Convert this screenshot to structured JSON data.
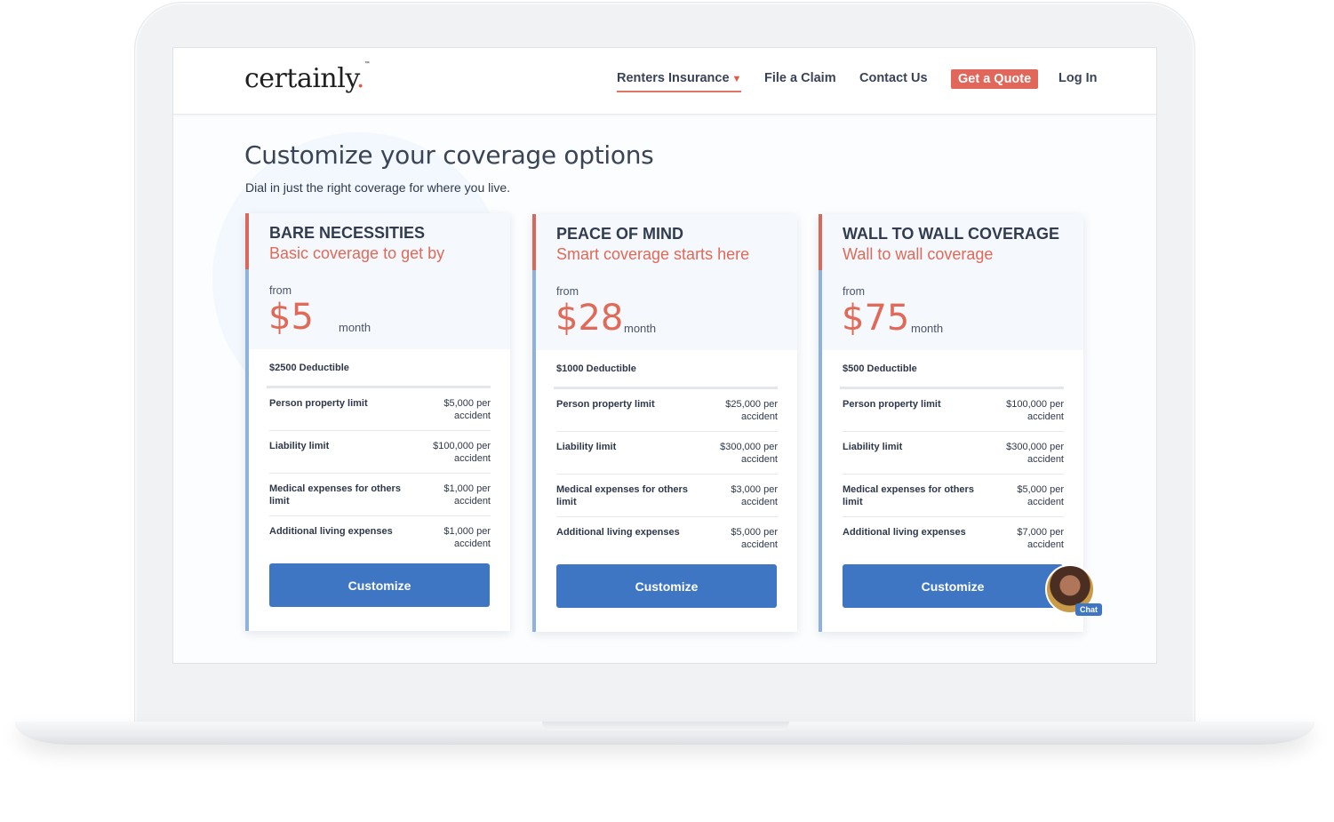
{
  "header": {
    "logo_text": "certainly",
    "logo_dot": ".",
    "logo_tm": "™",
    "nav": {
      "renters": "Renters Insurance",
      "claim": "File a Claim",
      "contact": "Contact Us",
      "quote": "Get a Quote",
      "login": "Log In"
    }
  },
  "main": {
    "title": "Customize your coverage options",
    "subtitle": "Dial in just the right coverage for where you live."
  },
  "plans": [
    {
      "name": "BARE NECESSITIES",
      "tagline": "Basic coverage to get by",
      "from": "from",
      "price": "$5",
      "per": "month",
      "deductible": "$2500 Deductible",
      "rows": [
        {
          "label": "Person property limit",
          "value": "$5,000 per accident"
        },
        {
          "label": "Liability limit",
          "value": "$100,000 per accident"
        },
        {
          "label": "Medical expenses for others limit",
          "value": "$1,000 per accident"
        },
        {
          "label": "Additional living expenses",
          "value": "$1,000 per accident"
        }
      ],
      "button": "Customize"
    },
    {
      "name": "PEACE OF MIND",
      "tagline": "Smart coverage starts here",
      "from": "from",
      "price": "$28",
      "per": "month",
      "deductible": "$1000 Deductible",
      "rows": [
        {
          "label": "Person property limit",
          "value": "$25,000 per accident"
        },
        {
          "label": "Liability limit",
          "value": "$300,000 per accident"
        },
        {
          "label": "Medical expenses for others limit",
          "value": "$3,000 per accident"
        },
        {
          "label": "Additional living expenses",
          "value": "$5,000 per accident"
        }
      ],
      "button": "Customize"
    },
    {
      "name": "WALL TO WALL COVERAGE",
      "tagline": "Wall to wall coverage",
      "from": "from",
      "price": "$75",
      "per": "month",
      "deductible": "$500 Deductible",
      "rows": [
        {
          "label": "Person property limit",
          "value": "$100,000 per accident"
        },
        {
          "label": "Liability limit",
          "value": "$300,000 per accident"
        },
        {
          "label": "Medical expenses for others limit",
          "value": "$5,000 per accident"
        },
        {
          "label": "Additional living expenses",
          "value": "$7,000 per accident"
        }
      ],
      "button": "Customize"
    }
  ],
  "chat": {
    "label": "Chat"
  },
  "colors": {
    "accent_red": "#e06957",
    "button_blue": "#3f76c4",
    "quote_button": "#e0675a",
    "accent_blue": "#8db2de"
  }
}
